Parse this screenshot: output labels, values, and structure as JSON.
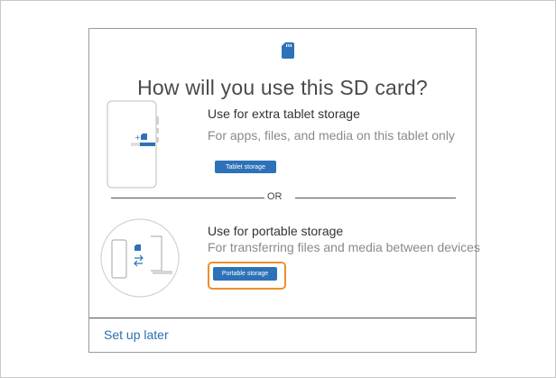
{
  "dialog": {
    "title": "How will you use this SD card?",
    "sd_icon": "sd-card-icon",
    "options": [
      {
        "title": "Use for extra tablet storage",
        "description": "For apps, files, and media on this tablet only",
        "button_label": "Tablet storage",
        "illustration": "tablet-icon"
      },
      {
        "title": "Use for portable storage",
        "description": "For transferring files and media between devices",
        "button_label": "Portable storage",
        "illustration": "transfer-devices-icon"
      }
    ],
    "separator_label": "OR",
    "footer_link": "Set up later"
  },
  "colors": {
    "accent": "#2d72b8",
    "highlight": "#ee8e2e",
    "link": "#2a6fb0"
  }
}
